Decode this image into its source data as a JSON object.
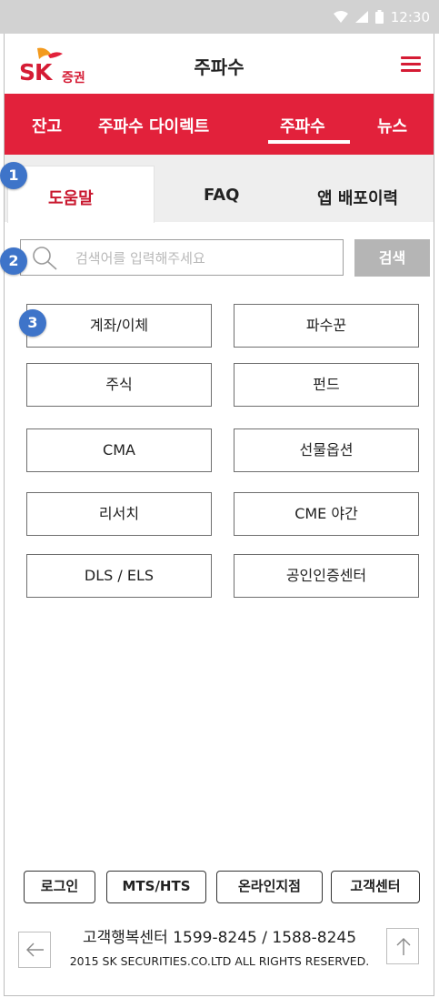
{
  "status_bar": {
    "time": "12:30"
  },
  "header": {
    "logo_text": "SK",
    "logo_sub": "증권",
    "title": "주파수"
  },
  "nav": {
    "items": [
      {
        "label": "잔고"
      },
      {
        "label": "주파수 다이렉트"
      },
      {
        "label": "주파수"
      },
      {
        "label": "뉴스"
      }
    ],
    "active_index": 2
  },
  "subtabs": [
    {
      "label": "도움말"
    },
    {
      "label": "FAQ"
    },
    {
      "label": "앱 배포이력"
    }
  ],
  "badges": [
    "1",
    "2",
    "3"
  ],
  "search": {
    "placeholder": "검색어를 입력해주세요",
    "button_label": "검색"
  },
  "categories": [
    {
      "label": "계좌/이체"
    },
    {
      "label": "파수꾼"
    },
    {
      "label": "주식"
    },
    {
      "label": "펀드"
    },
    {
      "label": "CMA"
    },
    {
      "label": "선물옵션"
    },
    {
      "label": "리서치"
    },
    {
      "label": "CME 야간"
    },
    {
      "label": "DLS / ELS"
    },
    {
      "label": "공인인증센터"
    }
  ],
  "footer": {
    "buttons": [
      {
        "label": "로그인"
      },
      {
        "label": "MTS/HTS"
      },
      {
        "label": "온라인지점"
      },
      {
        "label": "고객센터"
      }
    ],
    "hotline": "고객행복센터 1599-8245 / 1588-8245",
    "copyright": "2015 SK SECURITIES.CO.LTD ALL RIGHTS RESERVED."
  },
  "colors": {
    "brand_red": "#e2213b",
    "badge_blue": "#3e74c9",
    "search_button_gray": "#b5b5b5"
  }
}
